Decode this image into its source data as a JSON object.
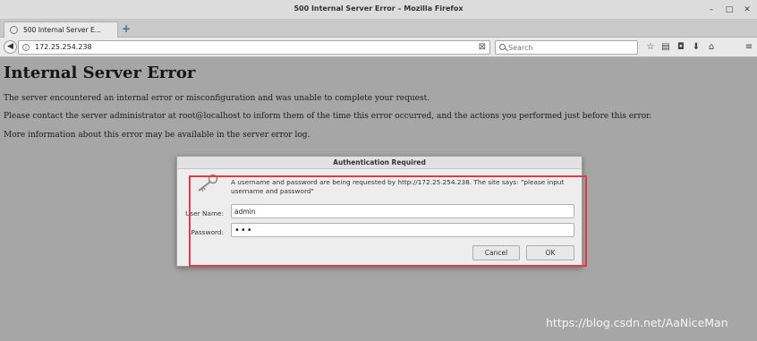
{
  "window": {
    "title": "500 Internal Server Error – Mozilla Firefox",
    "controls": {
      "minimize": "–",
      "maximize": "□",
      "close": "✕"
    }
  },
  "tabs": [
    {
      "label": "500 Internal Server E...",
      "icon": "globe-icon"
    }
  ],
  "new_tab_label": "+",
  "navbar": {
    "url": "172.25.254.238",
    "search_placeholder": "Search",
    "icons": [
      "back-arrow-icon",
      "info-icon",
      "clear-icon",
      "search-icon",
      "star-icon",
      "reading-list-icon",
      "pocket-icon",
      "download-icon",
      "home-icon",
      "menu-icon"
    ]
  },
  "page": {
    "heading": "Internal Server Error",
    "line1": "The server encountered an internal error or misconfiguration and was unable to complete your request.",
    "line2": "Please contact the server administrator at root@localhost to inform them of the time this error occurred, and the actions you performed just before this error.",
    "line3": "More information about this error may be available in the server error log."
  },
  "dialog": {
    "title": "Authentication Required",
    "message": "A username and password are being requested by http://172.25.254.238. The site says: \"please input username and password\"",
    "username_label": "User Name:",
    "username_value": "admin",
    "password_label": "Password:",
    "password_value": "•••",
    "cancel_label": "Cancel",
    "ok_label": "OK",
    "highlight_color": "#e63946"
  },
  "watermark": "https://blog.csdn.net/AaNiceMan"
}
